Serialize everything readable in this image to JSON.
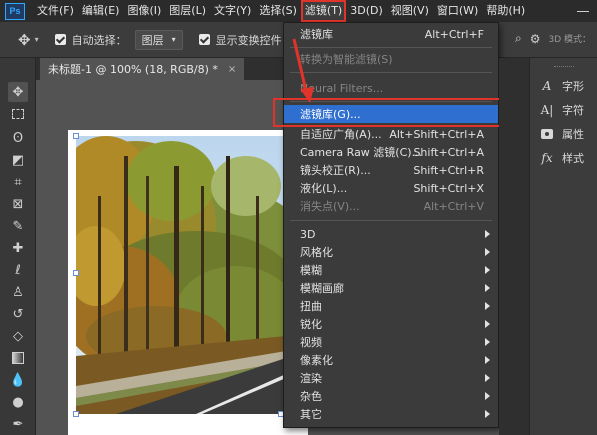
{
  "menubar": {
    "logo": "Ps",
    "items": [
      "文件(F)",
      "编辑(E)",
      "图像(I)",
      "图层(L)",
      "文字(Y)",
      "选择(S)",
      "滤镜(T)",
      "3D(D)",
      "视图(V)",
      "窗口(W)",
      "帮助(H)"
    ],
    "active_index": 6
  },
  "options": {
    "auto_select_label": "自动选择：",
    "layer_select_value": "图层",
    "show_transform_label": "显示变换控件",
    "mode_3d_label": "3D 模式："
  },
  "document_tab": {
    "title": "未标题-1 @ 100% (18, RGB/8) *",
    "close": "×"
  },
  "filter_menu": {
    "item_last_filter": {
      "label": "滤镜库",
      "shortcut": "Alt+Ctrl+F"
    },
    "item_smart_filters": {
      "label": "转换为智能滤镜(S)"
    },
    "item_neural": {
      "label": "Neural Filters..."
    },
    "item_gallery": {
      "label": "滤镜库(G)..."
    },
    "item_adaptive_wide": {
      "label": "自适应广角(A)...",
      "shortcut": "Alt+Shift+Ctrl+A"
    },
    "item_camera_raw": {
      "label": "Camera Raw 滤镜(C)...",
      "shortcut": "Shift+Ctrl+A"
    },
    "item_lens_correction": {
      "label": "镜头校正(R)...",
      "shortcut": "Shift+Ctrl+R"
    },
    "item_liquify": {
      "label": "液化(L)...",
      "shortcut": "Shift+Ctrl+X"
    },
    "item_vanishing_point": {
      "label": "消失点(V)...",
      "shortcut": "Alt+Ctrl+V"
    },
    "submenus": [
      "3D",
      "风格化",
      "模糊",
      "模糊画廊",
      "扭曲",
      "锐化",
      "视频",
      "像素化",
      "渲染",
      "杂色",
      "其它"
    ]
  },
  "right_panel": {
    "items": [
      "字形",
      "字符",
      "属性",
      "样式"
    ]
  },
  "colors": {
    "highlight": "#2f6fd0",
    "annotation_red": "#e0332a",
    "menu_bg": "#3b3b3b"
  }
}
